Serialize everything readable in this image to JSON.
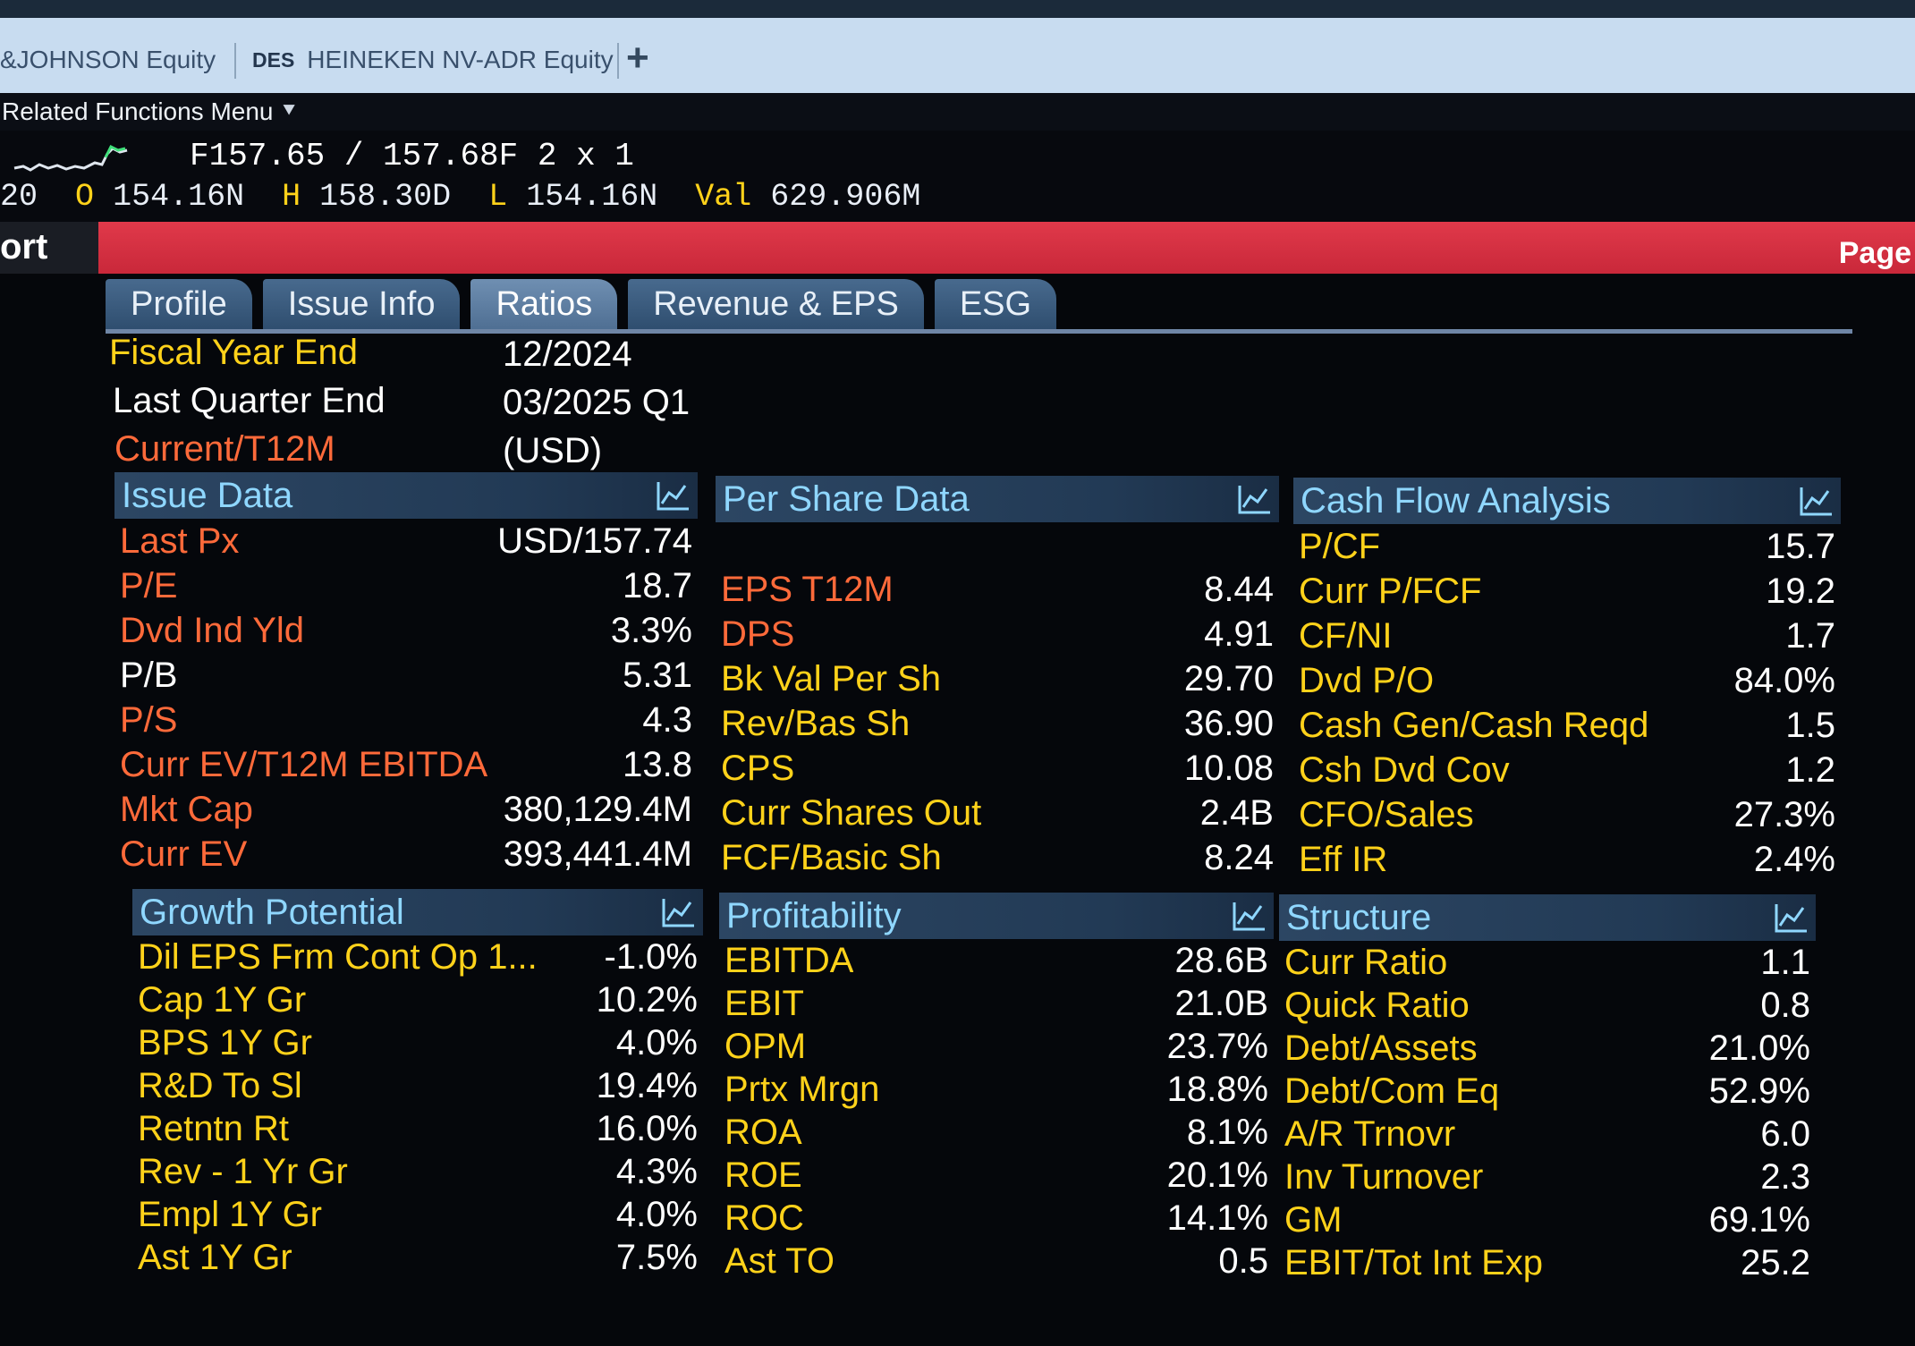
{
  "window_tabs": [
    {
      "mnemonic": "",
      "label": "&JOHNSON Equity"
    },
    {
      "mnemonic": "DES",
      "label": "HEINEKEN NV-ADR Equity"
    }
  ],
  "add_tab": "+",
  "related_menu": "Related Functions Menu",
  "quote": {
    "line1": "F157.65 / 157.68F  2 x 1",
    "line2_prefix": "20",
    "open_label": "O",
    "open": "154.16N",
    "high_label": "H",
    "high": "158.30D",
    "low_label": "L",
    "low": "154.16N",
    "val_label": "Val",
    "val": "629.906M"
  },
  "title_fragment": "ort",
  "page_label": "Page",
  "tabs": [
    "Profile",
    "Issue Info",
    "Ratios",
    "Revenue & EPS",
    "ESG"
  ],
  "active_tab": "Ratios",
  "header": {
    "fiscal_year_end_label": "Fiscal Year End",
    "fiscal_year_end": "12/2024",
    "last_quarter_end_label": "Last Quarter End",
    "last_quarter_end": "03/2025 Q1",
    "current_label": "Current/T12M",
    "currency": "(USD)"
  },
  "issue_data": {
    "title": "Issue Data",
    "rows": [
      {
        "label": "Last Px",
        "value": "USD/157.74"
      },
      {
        "label": "P/E",
        "value": "18.7"
      },
      {
        "label": "Dvd Ind Yld",
        "value": "3.3%"
      },
      {
        "label": "P/B",
        "value": "5.31"
      },
      {
        "label": "P/S",
        "value": "4.3"
      },
      {
        "label": "Curr EV/T12M EBITDA",
        "value": "13.8"
      },
      {
        "label": "Mkt Cap",
        "value": "380,129.4M"
      },
      {
        "label": "Curr EV",
        "value": "393,441.4M"
      }
    ]
  },
  "per_share": {
    "title": "Per Share Data",
    "rows": [
      {
        "label": "EPS T12M",
        "value": "8.44"
      },
      {
        "label": "DPS",
        "value": "4.91"
      },
      {
        "label": "Bk Val Per Sh",
        "value": "29.70"
      },
      {
        "label": "Rev/Bas Sh",
        "value": "36.90"
      },
      {
        "label": "CPS",
        "value": "10.08"
      },
      {
        "label": "Curr Shares Out",
        "value": "2.4B"
      },
      {
        "label": "FCF/Basic Sh",
        "value": "8.24"
      }
    ]
  },
  "cash_flow": {
    "title": "Cash Flow Analysis",
    "rows": [
      {
        "label": "P/CF",
        "value": "15.7"
      },
      {
        "label": "Curr P/FCF",
        "value": "19.2"
      },
      {
        "label": "CF/NI",
        "value": "1.7"
      },
      {
        "label": "Dvd P/O",
        "value": "84.0%"
      },
      {
        "label": "Cash Gen/Cash Reqd",
        "value": "1.5"
      },
      {
        "label": "Csh Dvd Cov",
        "value": "1.2"
      },
      {
        "label": "CFO/Sales",
        "value": "27.3%"
      },
      {
        "label": "Eff IR",
        "value": "2.4%"
      }
    ]
  },
  "growth": {
    "title": "Growth Potential",
    "rows": [
      {
        "label": "Dil EPS Frm Cont Op 1...",
        "value": "-1.0%"
      },
      {
        "label": "Cap 1Y Gr",
        "value": "10.2%"
      },
      {
        "label": "BPS 1Y Gr",
        "value": "4.0%"
      },
      {
        "label": "R&D To Sl",
        "value": "19.4%"
      },
      {
        "label": "Retntn Rt",
        "value": "16.0%"
      },
      {
        "label": "Rev - 1 Yr Gr",
        "value": "4.3%"
      },
      {
        "label": "Empl 1Y Gr",
        "value": "4.0%"
      },
      {
        "label": "Ast 1Y Gr",
        "value": "7.5%"
      }
    ]
  },
  "profitability": {
    "title": "Profitability",
    "rows": [
      {
        "label": "EBITDA",
        "value": "28.6B"
      },
      {
        "label": "EBIT",
        "value": "21.0B"
      },
      {
        "label": "OPM",
        "value": "23.7%"
      },
      {
        "label": "Prtx Mrgn",
        "value": "18.8%"
      },
      {
        "label": "ROA",
        "value": "8.1%"
      },
      {
        "label": "ROE",
        "value": "20.1%"
      },
      {
        "label": "ROC",
        "value": "14.1%"
      },
      {
        "label": "Ast TO",
        "value": "0.5"
      }
    ]
  },
  "structure": {
    "title": "Structure",
    "rows": [
      {
        "label": "Curr Ratio",
        "value": "1.1"
      },
      {
        "label": "Quick Ratio",
        "value": "0.8"
      },
      {
        "label": "Debt/Assets",
        "value": "21.0%"
      },
      {
        "label": "Debt/Com Eq",
        "value": "52.9%"
      },
      {
        "label": "A/R Trnovr",
        "value": "6.0"
      },
      {
        "label": "Inv Turnover",
        "value": "2.3"
      },
      {
        "label": "GM",
        "value": "69.1%"
      },
      {
        "label": "EBIT/Tot Int Exp",
        "value": "25.2"
      }
    ]
  },
  "colors": {
    "label_orange": "#ff6a3a",
    "label_yellow": "#ffd21a",
    "section_title": "#8fd7ff",
    "title_bar": "#d4303f"
  },
  "icons": {
    "section_chart": "line-chart-icon",
    "sparkline": "sparkline-icon",
    "menu_chevron": "double-chevron-down-icon"
  }
}
